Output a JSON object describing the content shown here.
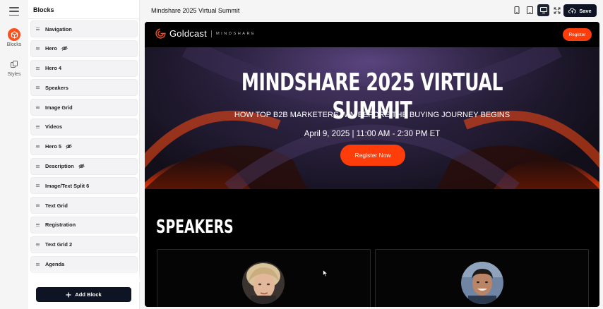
{
  "sidebar": {
    "rail": [
      {
        "label": "Blocks",
        "icon": "cube-icon",
        "active": true
      },
      {
        "label": "Styles",
        "icon": "layers-icon",
        "active": false
      }
    ]
  },
  "blocks_panel": {
    "title": "Blocks",
    "items": [
      {
        "label": "Navigation",
        "hidden": false
      },
      {
        "label": "Hero",
        "hidden": true
      },
      {
        "label": "Hero 4",
        "hidden": false
      },
      {
        "label": "Speakers",
        "hidden": false
      },
      {
        "label": "Image Grid",
        "hidden": false
      },
      {
        "label": "Videos",
        "hidden": false
      },
      {
        "label": "Hero 5",
        "hidden": true
      },
      {
        "label": "Description",
        "hidden": true
      },
      {
        "label": "Image/Text Split 6",
        "hidden": false
      },
      {
        "label": "Text Grid",
        "hidden": false
      },
      {
        "label": "Registration",
        "hidden": false
      },
      {
        "label": "Text Grid 2",
        "hidden": false
      },
      {
        "label": "Agenda",
        "hidden": false
      }
    ],
    "add_label": "Add Block"
  },
  "topbar": {
    "title": "Mindshare 2025 Virtual Summit",
    "save_label": "Save",
    "view_modes": [
      "mobile-icon",
      "tablet-icon",
      "desktop-icon",
      "fullscreen-icon"
    ],
    "active_view": "desktop-icon"
  },
  "preview": {
    "nav": {
      "brand": "Goldcast",
      "sub": "MINDSHARE",
      "register_label": "Register"
    },
    "hero": {
      "title": "MINDSHARE 2025 VIRTUAL SUMMIT",
      "subtitle": "HOW TOP B2B MARKETERS WIN BEFORE THE BUYING JOURNEY BEGINS",
      "date": "April 9, 2025 | 11:00 AM - 2:30 PM ET",
      "cta": "Register Now"
    },
    "speakers_title": "SPEAKERS"
  },
  "colors": {
    "accent": "#ff3d0a",
    "dark": "#0e1424",
    "preview_bg": "#000000"
  }
}
